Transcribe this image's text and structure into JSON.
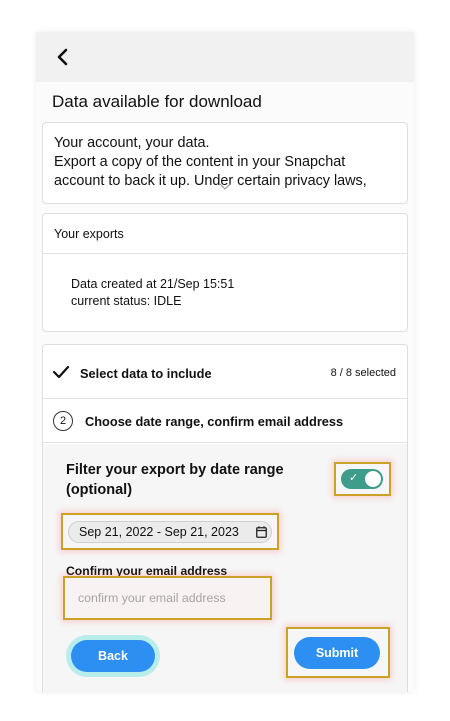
{
  "header": {
    "back_icon": "chevron-left-icon"
  },
  "page": {
    "heading": "Data available for download"
  },
  "intro": {
    "line1": "Your account, your data.",
    "line2": "Export a copy of the content in your Snapchat account to back it up. Under certain privacy laws,",
    "expand_icon": "chevron-down-icon"
  },
  "exports": {
    "title": "Your exports",
    "created": "Data created at 21/Sep 15:51",
    "status": "current status: IDLE"
  },
  "steps": {
    "step1": {
      "label": "Select data to include",
      "count": "8 / 8 selected",
      "icon": "checkmark-icon"
    },
    "step2": {
      "number": "2",
      "label": "Choose date range, confirm email address"
    }
  },
  "form": {
    "filter_label": "Filter your export by date range (optional)",
    "toggle_on": true,
    "toggle_check": "✓",
    "date_range": "Sep 21, 2022 - Sep 21, 2023",
    "email_label": "Confirm your email address",
    "email_placeholder": "confirm your email address",
    "email_value": ""
  },
  "buttons": {
    "back": "Back",
    "submit": "Submit"
  },
  "colors": {
    "accent": "#2d8ff2",
    "toggle": "#3e9c8b",
    "highlight": "#c9a227"
  }
}
